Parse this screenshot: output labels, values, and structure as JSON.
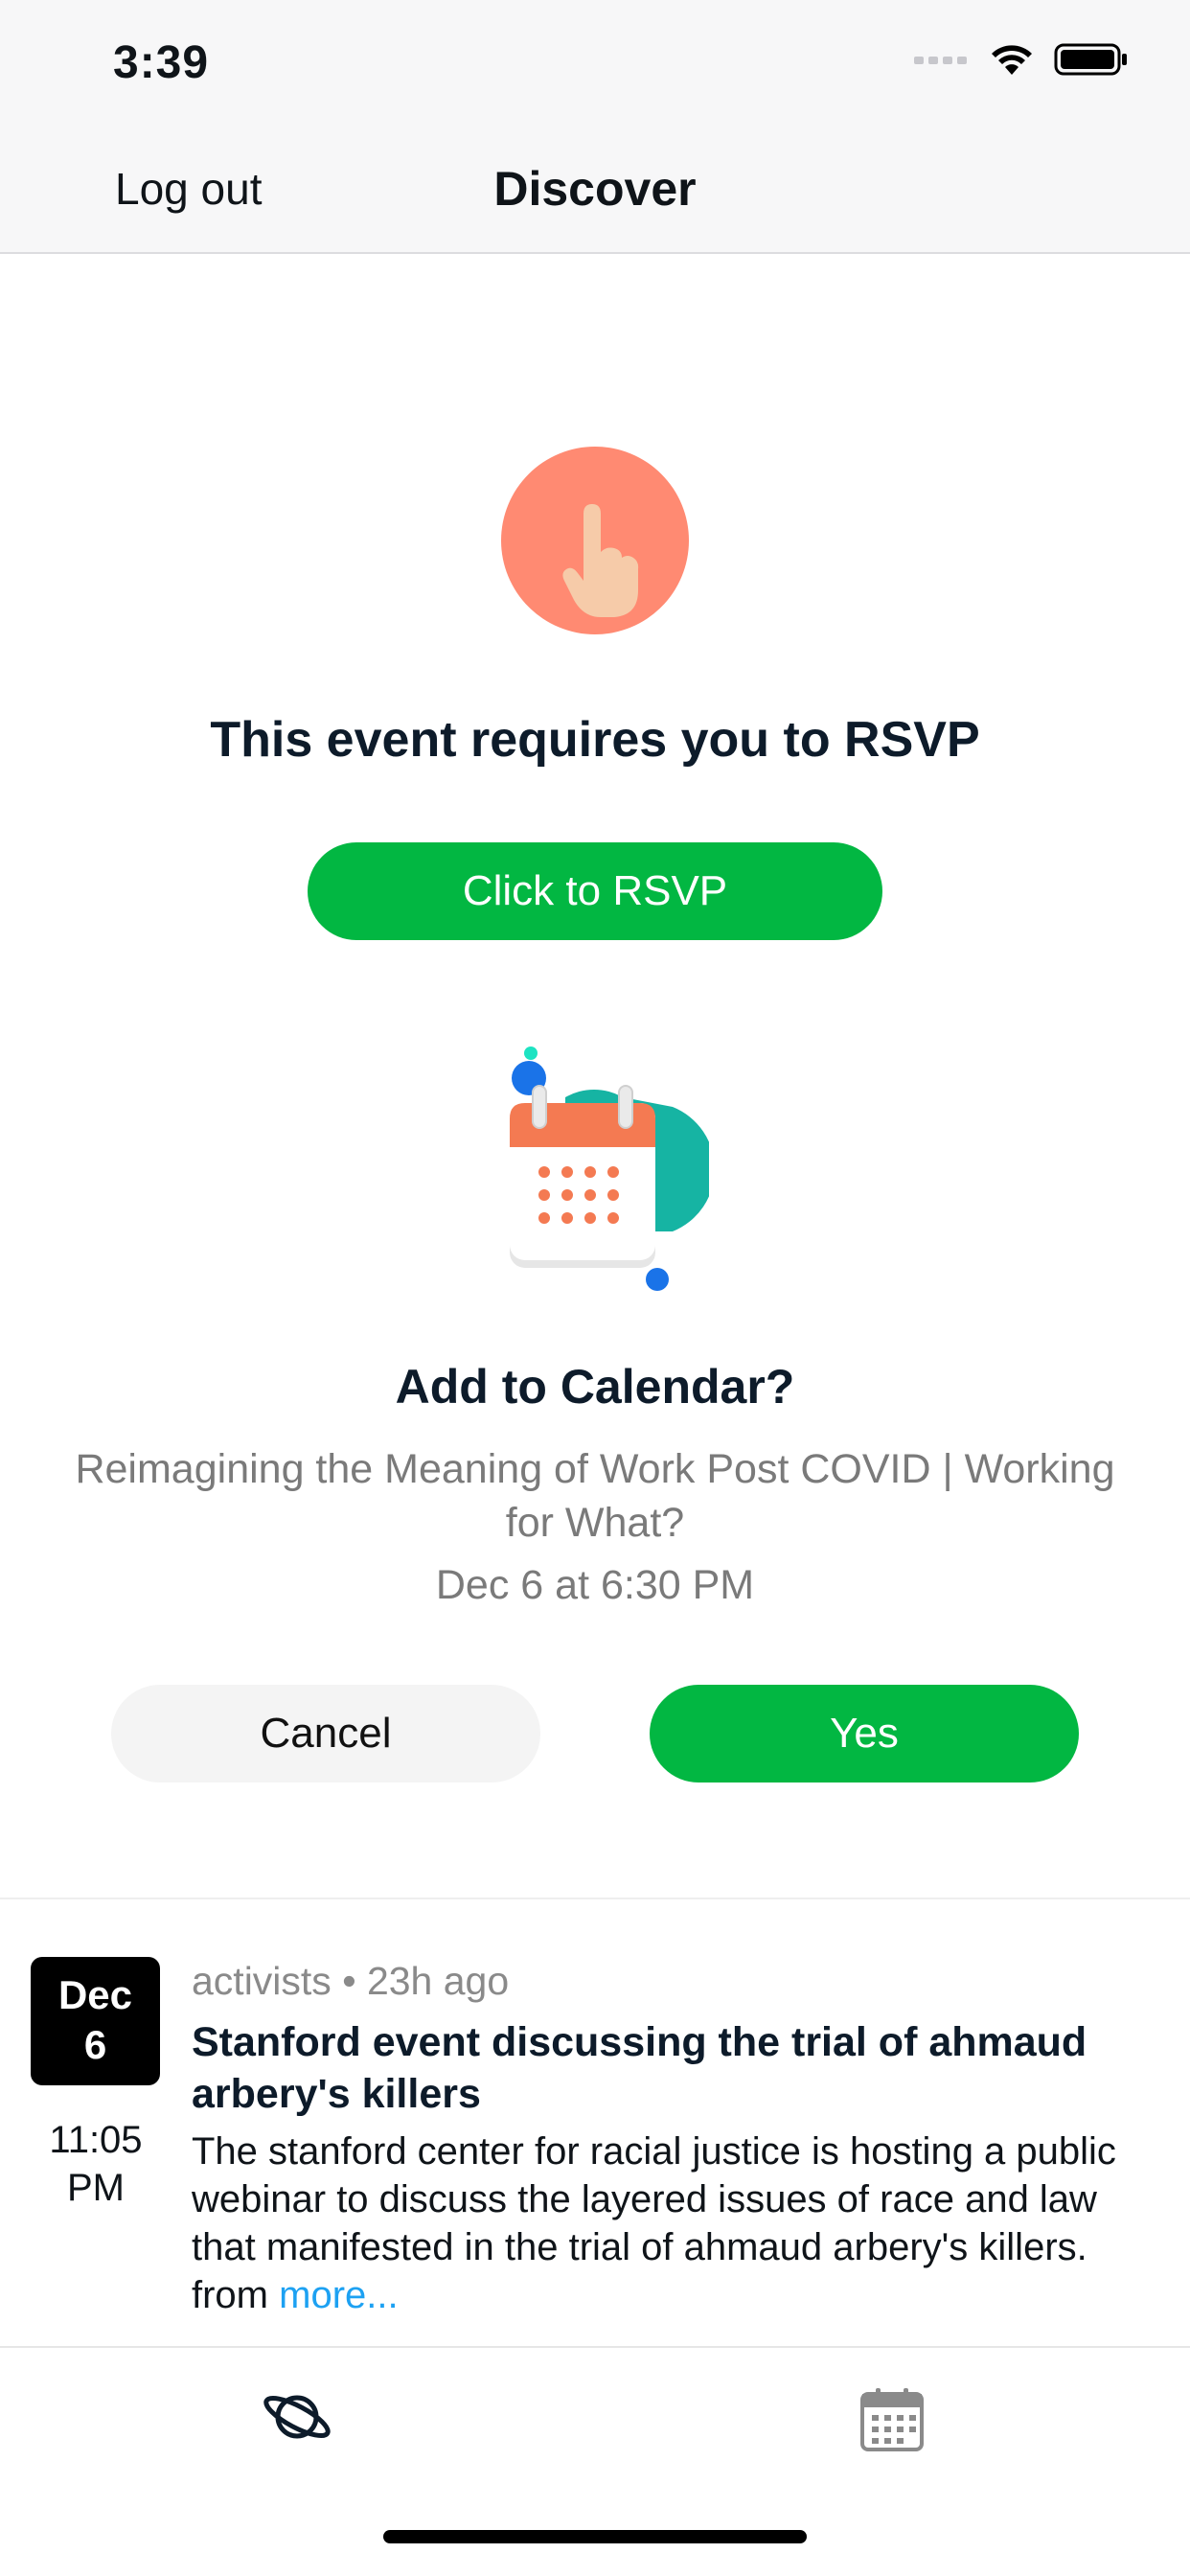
{
  "status_bar": {
    "time": "3:39"
  },
  "nav": {
    "left_label": "Log out",
    "title": "Discover"
  },
  "rsvp": {
    "title": "This event requires you to RSVP",
    "button_label": "Click to RSVP"
  },
  "calendar_prompt": {
    "title": "Add to Calendar?",
    "event_name": "Reimagining the Meaning of Work Post COVID | Working for What?",
    "event_datetime": "Dec 6 at 6:30 PM",
    "cancel_label": "Cancel",
    "yes_label": "Yes"
  },
  "feed_card": {
    "month": "Dec",
    "day": "6",
    "time_line1": "11:05",
    "time_line2": "PM",
    "meta": "activists • 23h ago",
    "title": "Stanford event discussing the trial of ahmaud arbery's killers",
    "body": "The stanford center for racial justice is hosting a public webinar to discuss the layered issues of race and law that manifested in the trial of ahmaud arbery's killers. from ",
    "more_label": "more..."
  },
  "tabbar": {
    "tabs": [
      {
        "name": "discover",
        "icon": "planet-icon"
      },
      {
        "name": "calendar",
        "icon": "calendar-icon"
      }
    ]
  },
  "colors": {
    "accent_green": "#02b742",
    "hand_circle": "#ff8a72",
    "link_blue": "#1da1f2",
    "muted_text": "#7a7a7a"
  }
}
